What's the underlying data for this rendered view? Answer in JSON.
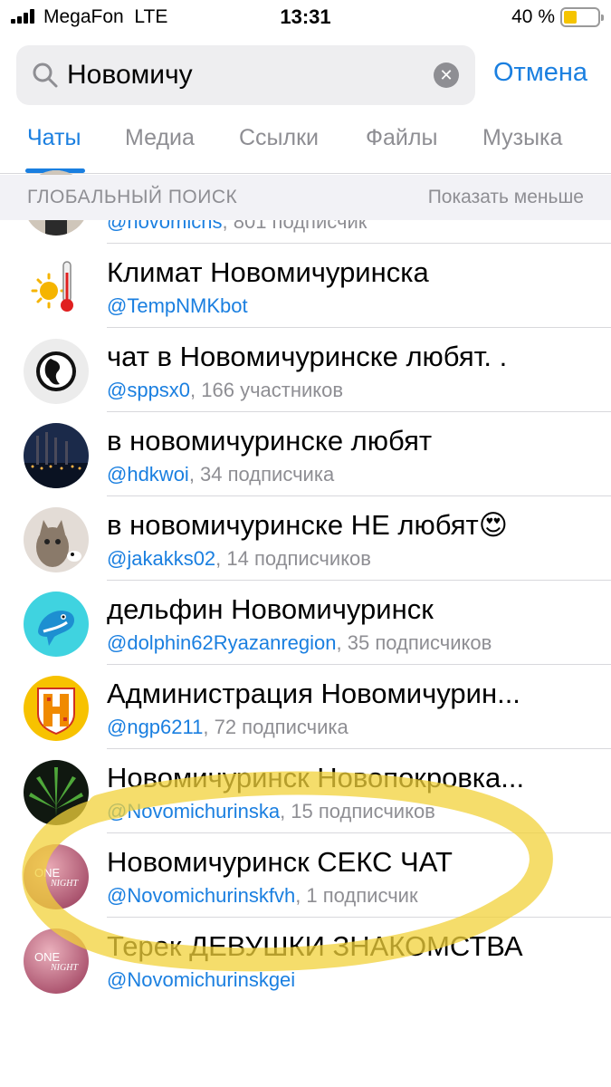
{
  "status_bar": {
    "carrier": "MegaFon",
    "network": "LTE",
    "time": "13:31",
    "battery": "40 %",
    "battery_level": 0.4,
    "battery_color": "#f5c400"
  },
  "search": {
    "query": "Новомичу",
    "cancel_label": "Отмена"
  },
  "tabs": [
    {
      "label": "Чаты",
      "active": true
    },
    {
      "label": "Медиа",
      "active": false
    },
    {
      "label": "Ссылки",
      "active": false
    },
    {
      "label": "Файлы",
      "active": false
    },
    {
      "label": "Музыка",
      "active": false
    }
  ],
  "section": {
    "title": "ГЛОБАЛЬНЫЙ ПОИСК",
    "action": "Показать меньше"
  },
  "results": [
    {
      "title": "",
      "handle": "@novomichs",
      "meta": ", 801 подписчик",
      "avatar_icon": "person-photo-icon"
    },
    {
      "title": "Климат Новомичуринска",
      "handle": "@TempNMKbot",
      "meta": "",
      "avatar_icon": "thermometer-sun-icon"
    },
    {
      "title": "чат в Новомичуринске любят. .",
      "handle": "@sppsx0",
      "meta": ", 166 участников",
      "avatar_icon": "silhouette-logo-icon"
    },
    {
      "title": "в новомичуринске любят",
      "handle": "@hdkwoi",
      "meta": ", 34 подписчика",
      "avatar_icon": "power-plant-night-icon"
    },
    {
      "title": "в новомичуринске НЕ любят😍",
      "handle": "@jakakks02",
      "meta": ", 14 подписчиков",
      "avatar_icon": "cat-photo-icon"
    },
    {
      "title": "дельфин Новомичуринск",
      "handle": "@dolphin62Ryazanregion",
      "meta": ", 35 подписчиков",
      "avatar_icon": "dolphin-icon"
    },
    {
      "title": "Администрация Новомичурин...",
      "handle": "@ngp6211",
      "meta": ", 72 подписчика",
      "avatar_icon": "coat-of-arms-icon"
    },
    {
      "title": "Новомичуринск Новопокровка...",
      "handle": "@Novomichurinska",
      "meta": ", 15 подписчиков",
      "avatar_icon": "leaf-icon"
    },
    {
      "title": "Новомичуринск СЕКС ЧАТ",
      "handle": "@Novomichurinskfvh",
      "meta": ", 1 подписчик",
      "avatar_icon": "one-night-icon",
      "avatar_text": "ONE",
      "avatar_subtext": "NIGHT"
    },
    {
      "title": "Терек ДЕВУШКИ ЗНАКОМСТВА",
      "handle": "@Novomichurinskgei",
      "meta": "",
      "avatar_icon": "one-night-icon",
      "avatar_text": "ONE",
      "avatar_subtext": "NIGHT"
    }
  ],
  "colors": {
    "accent": "#1a7fe0",
    "highlight": "#f2d23a"
  }
}
